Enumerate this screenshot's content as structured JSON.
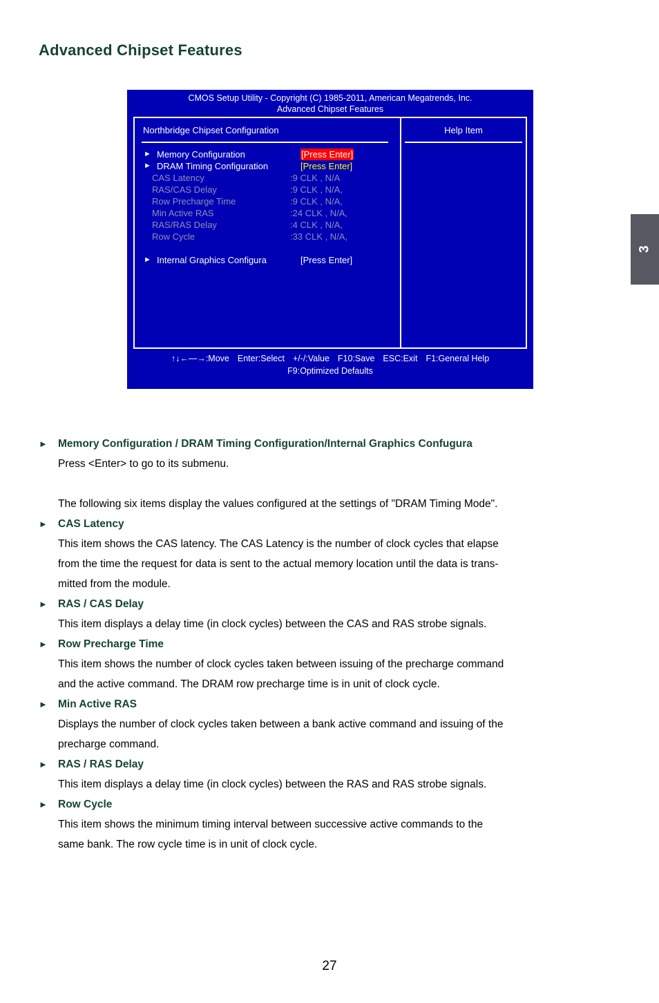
{
  "page": {
    "heading": "Advanced Chipset Features",
    "number": "27",
    "chapter_tab": "3",
    "accent_green": "#14452f",
    "bios_blue": "#0000b4",
    "tab_gray": "#565961"
  },
  "bios": {
    "title_line1": "CMOS Setup Utility - Copyright (C) 1985-2011, American Megatrends, Inc.",
    "title_line2": "Advanced Chipset Features",
    "section_title": "Northbridge Chipset Configuration",
    "help_title": "Help Item",
    "menu": [
      {
        "arrow": "►",
        "label": "Memory Configuration",
        "value": "[Press Enter]",
        "style": "highlight-red",
        "dim": false
      },
      {
        "arrow": "►",
        "label": "DRAM Timing Configuration",
        "value": "[Press Enter]",
        "style": "yellow",
        "dim": false
      },
      {
        "arrow": "",
        "label": "CAS Latency",
        "value": ":9 CLK ,  N/A",
        "style": "",
        "dim": true
      },
      {
        "arrow": "",
        "label": "RAS/CAS Delay",
        "value": ":9 CLK , N/A,",
        "style": "",
        "dim": true
      },
      {
        "arrow": "",
        "label": "Row Precharge Time",
        "value": ":9 CLK , N/A,",
        "style": "",
        "dim": true
      },
      {
        "arrow": "",
        "label": "Min Active RAS",
        "value": ":24 CLK , N/A,",
        "style": "",
        "dim": true
      },
      {
        "arrow": "",
        "label": "RAS/RAS Delay",
        "value": ":4 CLK , N/A,",
        "style": "",
        "dim": true
      },
      {
        "arrow": "",
        "label": "Row Cycle",
        "value": ":33 CLK , N/A,",
        "style": "",
        "dim": true
      },
      {
        "arrow": "",
        "label": "",
        "value": "",
        "style": "",
        "dim": false
      },
      {
        "arrow": "►",
        "label": "Internal Graphics Configura",
        "value": "[Press Enter]",
        "style": "",
        "dim": false
      }
    ],
    "footer_keys": [
      "↑↓←—→:Move",
      "Enter:Select",
      "+/-/:Value",
      "F10:Save",
      "ESC:Exit",
      "F1:General Help"
    ],
    "footer_defaults": "F9:Optimized Defaults"
  },
  "content": {
    "bullet_glyph": "►",
    "items": [
      {
        "heading": "Memory Configuration / DRAM Timing Configuration/Internal Graphics Confugura",
        "body": [
          "Press <Enter> to go to its submenu."
        ]
      }
    ],
    "intro_para": "The following six items display the values configured at the settings of \"DRAM Timing Mode\".",
    "settings": [
      {
        "heading": "CAS Latency",
        "body": [
          "This item shows the CAS latency. The CAS Latency is the number of clock cycles that elapse",
          "from the time the request for data is sent to the actual memory location until the data is trans-",
          "mitted from the module."
        ]
      },
      {
        "heading": "RAS / CAS Delay",
        "body": [
          "This item displays a delay time (in clock cycles) between the CAS and RAS strobe signals."
        ]
      },
      {
        "heading": "Row Precharge Time",
        "body": [
          "This item shows the number of clock cycles taken between issuing of the precharge command",
          "and the active command. The DRAM row precharge time is in unit of clock cycle."
        ]
      },
      {
        "heading": "Min Active RAS",
        "body": [
          "Displays the number of clock cycles taken between a bank active command and issuing of the",
          "precharge command."
        ]
      },
      {
        "heading": "RAS / RAS Delay",
        "body": [
          "This item displays a delay time (in clock cycles) between the RAS and RAS strobe signals."
        ]
      },
      {
        "heading": "Row Cycle",
        "body": [
          "This item shows the minimum timing interval between successive active commands to the",
          "same bank. The row cycle time is in unit of clock cycle."
        ]
      }
    ]
  }
}
